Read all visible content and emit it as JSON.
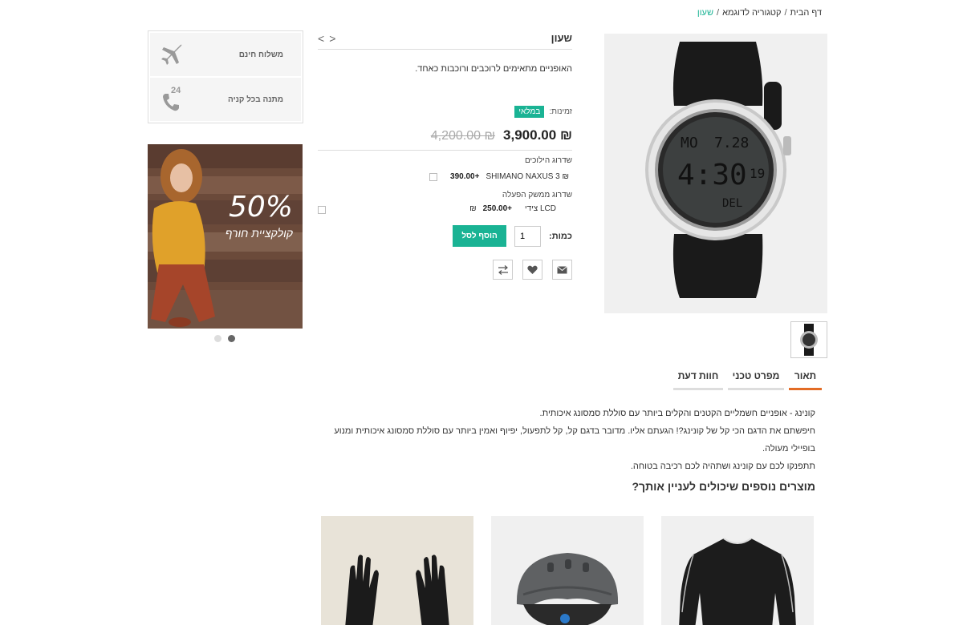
{
  "breadcrumb": {
    "home": "דף הבית",
    "category": "קטגוריה לדוגמא",
    "current": "שעון",
    "separator": "/"
  },
  "product": {
    "title": "שעון",
    "nav_prev": "<",
    "nav_next": ">",
    "description": "האופניים מתאימים לרוכבים ורוכבות כאחד.",
    "availability_label": "זמינות:",
    "availability_value": "במלאי",
    "price": "3,900.00",
    "currency": "₪",
    "old_price": "4,200.00",
    "option_group_1": "שדרוג הילוכים",
    "option_1_label": "SHIMANO NAXUS 3",
    "option_1_price": "+390.00",
    "option_group_2": "שדרוג ממשק הפעלה",
    "option_2_label": "LCD צידי",
    "option_2_price": "+250.00",
    "qty_label": "כמות:",
    "qty_value": "1",
    "add_to_cart": "הוסף לסל"
  },
  "features": {
    "free_shipping": "משלוח חינם",
    "gift": "מתנה בכל קניה",
    "gift_icon_number": "24"
  },
  "banner": {
    "percent": "50%",
    "subtitle": "קולקציית חורף"
  },
  "tabs": {
    "description": "תאור",
    "specs": "מפרט טכני",
    "reviews": "חוות דעת"
  },
  "tab_content": {
    "line1": "קונינג - אופניים חשמליים הקטנים והקלים ביותר עם סוללת סמסונג איכותית.",
    "line2": "חיפשתם את הדגם הכי קל של קונינג?! הגעתם אליו. מדובר בדגם קל, קל לתפעול, יפיוף ואמין ביותר עם סוללת סמסונג איכותית ומנוע בופיילי מעולה.",
    "line3": "תתפנקו לכם עם קונינג ושתהיה לכם רכיבה בטוחה."
  },
  "related": {
    "title": "מוצרים נוספים שיכולים לעניין אותך?"
  },
  "watch_display": {
    "top_left": "MO",
    "top_right": "7.28",
    "time": "4:30",
    "seconds": "19",
    "bottom": "DEL"
  },
  "colors": {
    "accent": "#1ab394",
    "tab_active": "#e36c25"
  }
}
